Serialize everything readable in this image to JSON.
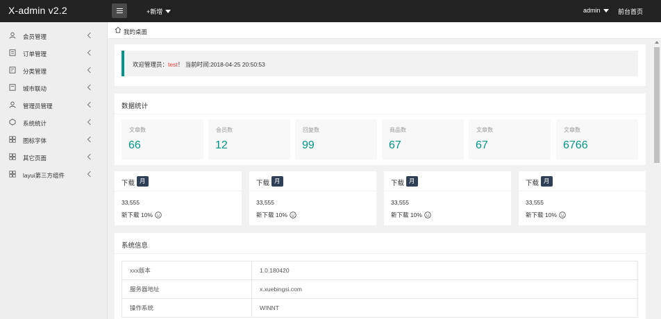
{
  "header": {
    "logo": "X-admin v2.2",
    "add_new": "+新增",
    "user": "admin",
    "front_home": "前台首页"
  },
  "sidebar": {
    "items": [
      {
        "label": "会员管理",
        "icon": "user-icon"
      },
      {
        "label": "订单管理",
        "icon": "order-icon"
      },
      {
        "label": "分类管理",
        "icon": "category-icon"
      },
      {
        "label": "城市联动",
        "icon": "city-icon"
      },
      {
        "label": "管理员管理",
        "icon": "admin-icon"
      },
      {
        "label": "系统统计",
        "icon": "stats-icon"
      },
      {
        "label": "图标字体",
        "icon": "grid-icon"
      },
      {
        "label": "其它页面",
        "icon": "grid-icon"
      },
      {
        "label": "layui第三方组件",
        "icon": "grid-icon"
      }
    ]
  },
  "breadcrumb": {
    "label": "我的桌面"
  },
  "welcome": {
    "prefix": "欢迎管理员：",
    "user": "test",
    "suffix": "！ 当前时间:2018-04-25 20:50:53"
  },
  "stats": {
    "title": "数据统计",
    "items": [
      {
        "label": "文章数",
        "value": "66"
      },
      {
        "label": "会员数",
        "value": "12"
      },
      {
        "label": "回复数",
        "value": "99"
      },
      {
        "label": "商品数",
        "value": "67"
      },
      {
        "label": "文章数",
        "value": "67"
      },
      {
        "label": "文章数",
        "value": "6766"
      }
    ]
  },
  "downloads": [
    {
      "title": "下载",
      "badge": "月",
      "count": "33,555",
      "growth": "新下载 10%"
    },
    {
      "title": "下载",
      "badge": "月",
      "count": "33,555",
      "growth": "新下载 10%"
    },
    {
      "title": "下载",
      "badge": "月",
      "count": "33,555",
      "growth": "新下载 10%"
    },
    {
      "title": "下载",
      "badge": "月",
      "count": "33,555",
      "growth": "新下载 10%"
    }
  ],
  "system": {
    "title": "系统信息",
    "rows": [
      {
        "key": "xxx版本",
        "value": "1.0.180420"
      },
      {
        "key": "服务器地址",
        "value": "x.xuebingsi.com"
      },
      {
        "key": "操作系统",
        "value": "WINNT"
      }
    ]
  },
  "colors": {
    "topbar": "#222222",
    "accent": "#009688",
    "badge": "#2f4056",
    "highlight": "#ff3333"
  }
}
